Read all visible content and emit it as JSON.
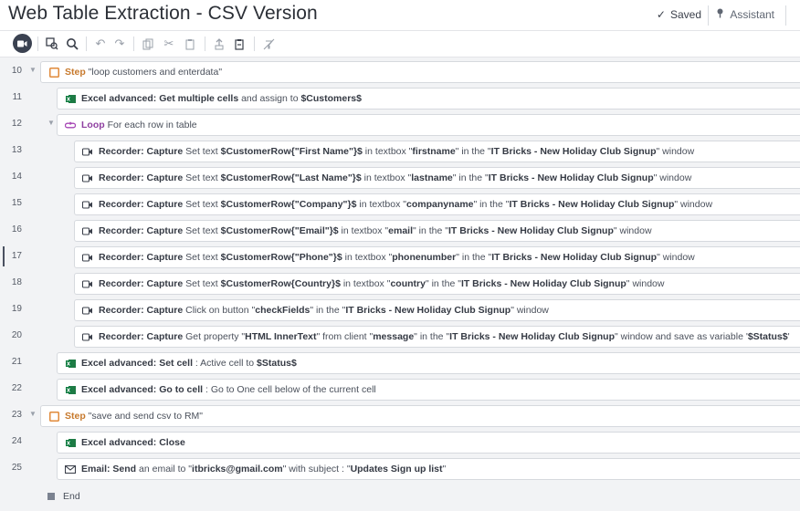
{
  "window": {
    "title": "Web Table Extraction - CSV Version",
    "saved": "Saved",
    "assistant": "Assistant"
  },
  "toolbar_icons": [
    "record-icon",
    "find-icon",
    "search-icon",
    "undo-icon",
    "redo-icon",
    "copy-icon",
    "cut-icon",
    "paste-icon",
    "export-icon",
    "clipboard-icon",
    "disable-icon"
  ],
  "lines": [
    {
      "n": "10",
      "type": "step",
      "segs": [
        [
          "kw",
          "Step "
        ],
        [
          "t",
          "\"loop customers and enterdata\""
        ]
      ]
    },
    {
      "n": "11",
      "type": "excel",
      "segs": [
        [
          "b",
          "Excel advanced: Get multiple cells"
        ],
        [
          "t",
          " and assign to "
        ],
        [
          "b",
          "$Customers$"
        ]
      ]
    },
    {
      "n": "12",
      "type": "loop",
      "segs": [
        [
          "lk",
          "Loop"
        ],
        [
          "t",
          " For each row in table"
        ]
      ]
    },
    {
      "n": "13",
      "type": "rec",
      "segs": [
        [
          "b",
          "Recorder: Capture"
        ],
        [
          "t",
          " Set text "
        ],
        [
          "b",
          "$CustomerRow{\"First Name\"}$"
        ],
        [
          "t",
          " in textbox \""
        ],
        [
          "b",
          "firstname"
        ],
        [
          "t",
          "\" in the \""
        ],
        [
          "b",
          "IT Bricks - New Holiday Club Signup"
        ],
        [
          "t",
          "\" window"
        ]
      ]
    },
    {
      "n": "14",
      "type": "rec",
      "segs": [
        [
          "b",
          "Recorder: Capture"
        ],
        [
          "t",
          " Set text "
        ],
        [
          "b",
          "$CustomerRow{\"Last Name\"}$"
        ],
        [
          "t",
          " in textbox \""
        ],
        [
          "b",
          "lastname"
        ],
        [
          "t",
          "\" in the \""
        ],
        [
          "b",
          "IT Bricks - New Holiday Club Signup"
        ],
        [
          "t",
          "\" window"
        ]
      ]
    },
    {
      "n": "15",
      "type": "rec",
      "segs": [
        [
          "b",
          "Recorder: Capture"
        ],
        [
          "t",
          " Set text "
        ],
        [
          "b",
          "$CustomerRow{\"Company\"}$"
        ],
        [
          "t",
          " in textbox \""
        ],
        [
          "b",
          "companyname"
        ],
        [
          "t",
          "\" in the \""
        ],
        [
          "b",
          "IT Bricks - New Holiday Club Signup"
        ],
        [
          "t",
          "\" window"
        ]
      ]
    },
    {
      "n": "16",
      "type": "rec",
      "segs": [
        [
          "b",
          "Recorder: Capture"
        ],
        [
          "t",
          " Set text "
        ],
        [
          "b",
          "$CustomerRow{\"Email\"}$"
        ],
        [
          "t",
          " in textbox \""
        ],
        [
          "b",
          "email"
        ],
        [
          "t",
          "\" in the \""
        ],
        [
          "b",
          "IT Bricks - New Holiday Club Signup"
        ],
        [
          "t",
          "\" window"
        ]
      ]
    },
    {
      "n": "17",
      "type": "rec",
      "segs": [
        [
          "b",
          "Recorder: Capture"
        ],
        [
          "t",
          " Set text "
        ],
        [
          "b",
          "$CustomerRow{\"Phone\"}$"
        ],
        [
          "t",
          " in textbox \""
        ],
        [
          "b",
          "phonenumber"
        ],
        [
          "t",
          "\" in the \""
        ],
        [
          "b",
          "IT Bricks - New Holiday Club Signup"
        ],
        [
          "t",
          "\" window"
        ]
      ]
    },
    {
      "n": "18",
      "type": "rec",
      "segs": [
        [
          "b",
          "Recorder: Capture"
        ],
        [
          "t",
          " Set text "
        ],
        [
          "b",
          "$CustomerRow{Country}$"
        ],
        [
          "t",
          " in textbox \""
        ],
        [
          "b",
          "country"
        ],
        [
          "t",
          "\" in the \""
        ],
        [
          "b",
          "IT Bricks - New Holiday Club Signup"
        ],
        [
          "t",
          "\" window"
        ]
      ]
    },
    {
      "n": "19",
      "type": "rec",
      "segs": [
        [
          "b",
          "Recorder: Capture"
        ],
        [
          "t",
          " Click on button \""
        ],
        [
          "b",
          "checkFields"
        ],
        [
          "t",
          "\" in the \""
        ],
        [
          "b",
          "IT Bricks - New Holiday Club Signup"
        ],
        [
          "t",
          "\" window"
        ]
      ]
    },
    {
      "n": "20",
      "type": "rec",
      "segs": [
        [
          "b",
          "Recorder: Capture"
        ],
        [
          "t",
          " Get property \""
        ],
        [
          "b",
          "HTML InnerText"
        ],
        [
          "t",
          "\" from client \""
        ],
        [
          "b",
          "message"
        ],
        [
          "t",
          "\" in the \""
        ],
        [
          "b",
          "IT Bricks - New Holiday Club Signup"
        ],
        [
          "t",
          "\" window and save as variable '"
        ],
        [
          "b",
          "$Status$"
        ],
        [
          "t",
          "'"
        ]
      ]
    },
    {
      "n": "21",
      "type": "excel",
      "segs": [
        [
          "b",
          "Excel advanced: Set cell"
        ],
        [
          "t",
          " : Active cell to "
        ],
        [
          "b",
          "$Status$"
        ]
      ]
    },
    {
      "n": "22",
      "type": "excel",
      "segs": [
        [
          "b",
          "Excel advanced: Go to cell"
        ],
        [
          "t",
          " : Go to One cell below of the current cell"
        ]
      ]
    },
    {
      "n": "23",
      "type": "step",
      "segs": [
        [
          "kw",
          "Step "
        ],
        [
          "t",
          "\"save and send csv to RM\""
        ]
      ]
    },
    {
      "n": "24",
      "type": "excel",
      "segs": [
        [
          "b",
          "Excel advanced: Close"
        ]
      ]
    },
    {
      "n": "25",
      "type": "email",
      "segs": [
        [
          "b",
          "Email: Send"
        ],
        [
          "t",
          " an email to \""
        ],
        [
          "b",
          "itbricks@gmail.com"
        ],
        [
          "t",
          "\" with subject : \""
        ],
        [
          "b",
          "Updates Sign up list"
        ],
        [
          "t",
          "\""
        ]
      ]
    }
  ],
  "end_label": "End"
}
